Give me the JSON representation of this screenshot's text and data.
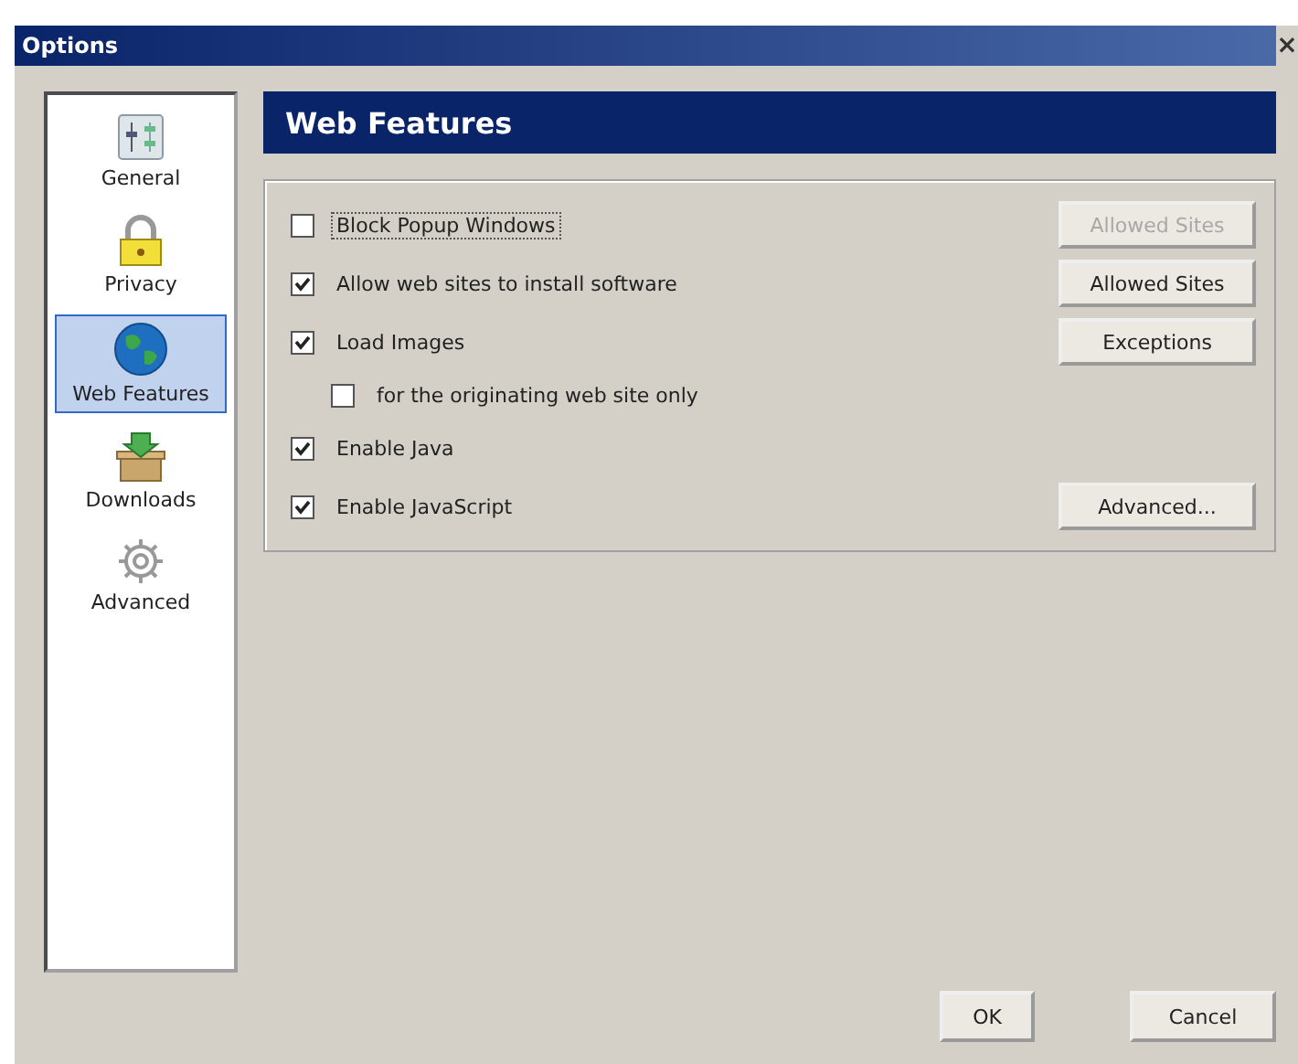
{
  "window": {
    "title": "Options",
    "close": "×"
  },
  "sidebar": {
    "items": [
      {
        "label": "General",
        "selected": false
      },
      {
        "label": "Privacy",
        "selected": false
      },
      {
        "label": "Web Features",
        "selected": true
      },
      {
        "label": "Downloads",
        "selected": false
      },
      {
        "label": "Advanced",
        "selected": false
      }
    ]
  },
  "panel": {
    "title": "Web Features",
    "options": [
      {
        "label": "Block Popup Windows",
        "checked": false,
        "focused": true,
        "button": {
          "label": "Allowed Sites",
          "disabled": true
        }
      },
      {
        "label": "Allow web sites to install software",
        "checked": true,
        "focused": false,
        "button": {
          "label": "Allowed Sites",
          "disabled": false
        }
      },
      {
        "label": "Load Images",
        "checked": true,
        "focused": false,
        "button": {
          "label": "Exceptions",
          "disabled": false
        },
        "children": [
          {
            "label": "for the originating web site only",
            "checked": false,
            "focused": false
          }
        ]
      },
      {
        "label": "Enable Java",
        "checked": true,
        "focused": false
      },
      {
        "label": "Enable JavaScript",
        "checked": true,
        "focused": false,
        "button": {
          "label": "Advanced...",
          "disabled": false
        }
      }
    ]
  },
  "buttons": [
    "OK",
    "Cancel"
  ]
}
